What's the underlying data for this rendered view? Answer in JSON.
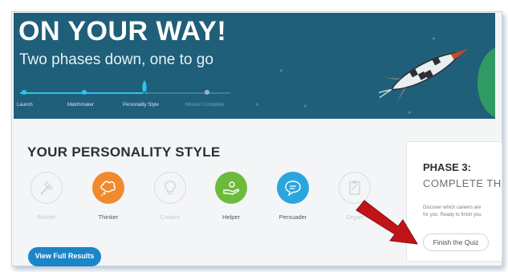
{
  "banner": {
    "title": "ON YOUR WAY!",
    "subtitle": "Two phases down, one to go",
    "steps": [
      {
        "label": "Launch",
        "done": true
      },
      {
        "label": "Matchmaker",
        "done": true
      },
      {
        "label": "Personality Style",
        "done": true,
        "current": true
      },
      {
        "label": "Mission Complete",
        "done": false
      }
    ],
    "colors": {
      "background": "#1f5f7a",
      "progress": "#2ec3f0"
    }
  },
  "personality": {
    "title": "YOUR PERSONALITY STYLE",
    "traits": [
      {
        "label": "Builder",
        "icon": "hammer-icon",
        "active": false
      },
      {
        "label": "Thinker",
        "icon": "thought-cloud-icon",
        "active": true,
        "color": "#f08a2e"
      },
      {
        "label": "Creator",
        "icon": "lightbulb-icon",
        "active": false
      },
      {
        "label": "Helper",
        "icon": "helping-hand-icon",
        "active": true,
        "color": "#6cbb3c"
      },
      {
        "label": "Persuader",
        "icon": "speech-bubble-icon",
        "active": true,
        "color": "#2aa6df"
      },
      {
        "label": "Organ",
        "icon": "clipboard-icon",
        "active": false
      }
    ],
    "full_results_label": "View Full Results"
  },
  "phase_card": {
    "title": "PHASE 3:",
    "subtitle": "COMPLETE TH",
    "description_line1": "Discover which careers are",
    "description_line2": "for you. Ready to finish you",
    "button_label": "Finish the Quiz"
  },
  "annotation": {
    "arrow_color": "#c0141a"
  }
}
